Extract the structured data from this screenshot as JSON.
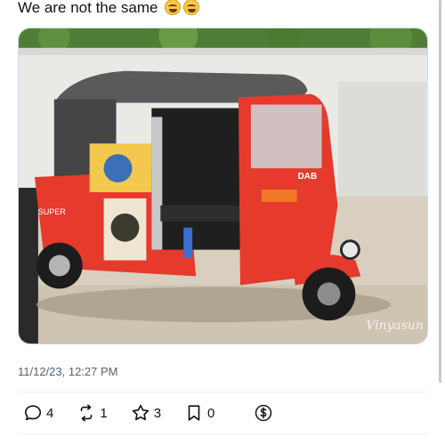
{
  "post": {
    "text": "We are not the same",
    "emojis": [
      "tears-of-joy",
      "tears-of-joy"
    ],
    "timestamp": "11/12/23, 12:27 PM"
  },
  "media": {
    "watermark": "Vinyasun",
    "vehicle_number_plate": "",
    "colors": {
      "body": "#e53a2c",
      "roof": "#5a5a5a",
      "wall": "#e9e9e6",
      "ground": "#d9cfbf"
    }
  },
  "actions": {
    "reply": {
      "icon": "reply-icon",
      "count": "4"
    },
    "repost": {
      "icon": "repost-icon",
      "count": "1"
    },
    "like": {
      "icon": "star-icon",
      "count": "3"
    },
    "bookmark": {
      "icon": "bookmark-icon",
      "count": "0"
    },
    "tip": {
      "icon": "dollar-icon"
    }
  }
}
